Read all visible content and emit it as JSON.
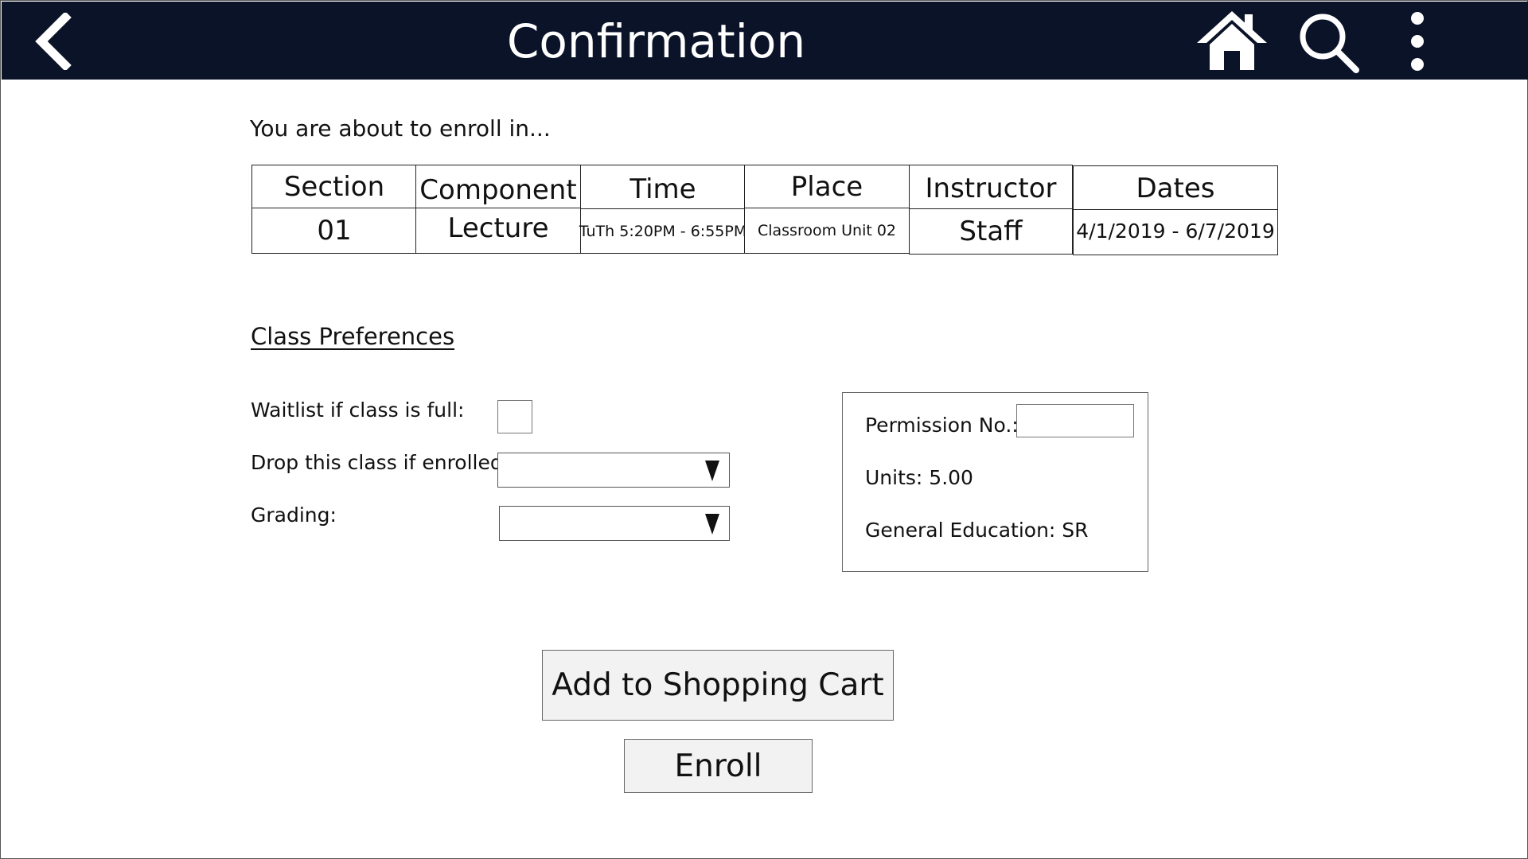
{
  "header": {
    "title": "Confirmation",
    "back_icon": "chevron-left-icon",
    "home_icon": "home-icon",
    "search_icon": "search-icon",
    "menu_icon": "more-vertical-icon",
    "background_color": "#0b1329"
  },
  "intro": "You are about to enroll in...",
  "table": {
    "headers": [
      "Section",
      "Component",
      "Time",
      "Place",
      "Instructor",
      "Dates"
    ],
    "row": [
      "01",
      "Lecture",
      "TuTh 5:20PM - 6:55PM",
      "Classroom Unit 02",
      "Staff",
      "4/1/2019 - 6/7/2019"
    ]
  },
  "preferences": {
    "heading": "Class Preferences",
    "waitlist_label": "Waitlist if class is full:",
    "drop_label": "Drop this class if enrolled:",
    "grading_label": "Grading:",
    "waitlist_checked": false,
    "drop_value": "",
    "grading_value": ""
  },
  "info": {
    "permission_label": "Permission No.:",
    "permission_value": "",
    "units": "Units: 5.00",
    "gen_ed": "General Education: SR"
  },
  "actions": {
    "cart_label": "Add to Shopping Cart",
    "enroll_label": "Enroll"
  }
}
